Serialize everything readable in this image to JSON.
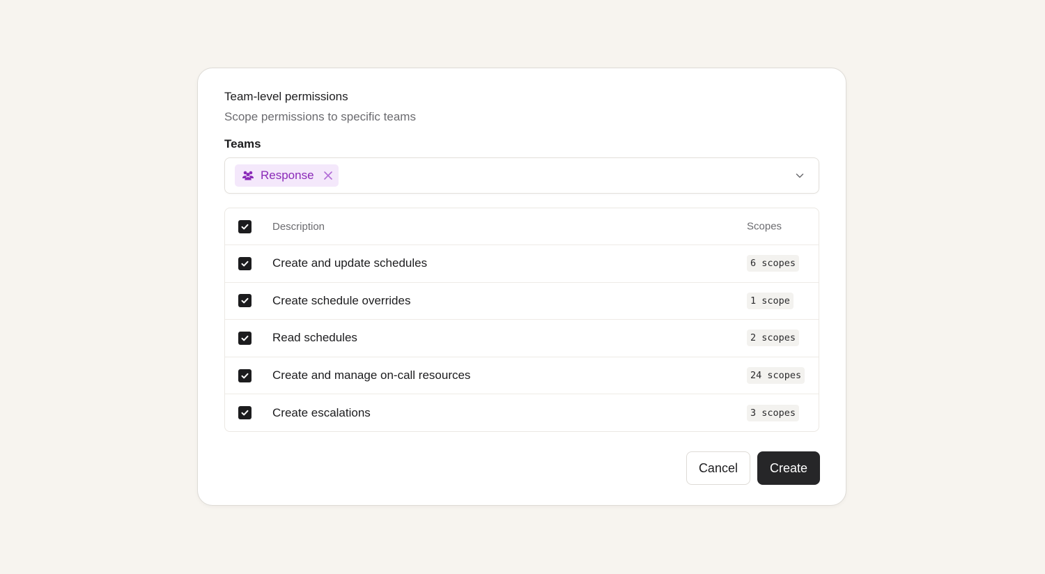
{
  "section": {
    "title": "Team-level permissions",
    "subtitle": "Scope permissions to specific teams"
  },
  "teams_field": {
    "label": "Teams",
    "selected": [
      {
        "label": "Response",
        "icon": "users-icon",
        "color": "#8a2ab8"
      }
    ]
  },
  "table": {
    "header": {
      "description": "Description",
      "scopes": "Scopes",
      "all_checked": true
    },
    "rows": [
      {
        "description": "Create and update schedules",
        "scopes": "6 scopes",
        "checked": true
      },
      {
        "description": "Create schedule overrides",
        "scopes": "1 scope",
        "checked": true
      },
      {
        "description": "Read schedules",
        "scopes": "2 scopes",
        "checked": true
      },
      {
        "description": "Create and manage on-call resources",
        "scopes": "24 scopes",
        "checked": true
      },
      {
        "description": "Create escalations",
        "scopes": "3 scopes",
        "checked": true
      }
    ]
  },
  "actions": {
    "cancel_label": "Cancel",
    "create_label": "Create"
  }
}
